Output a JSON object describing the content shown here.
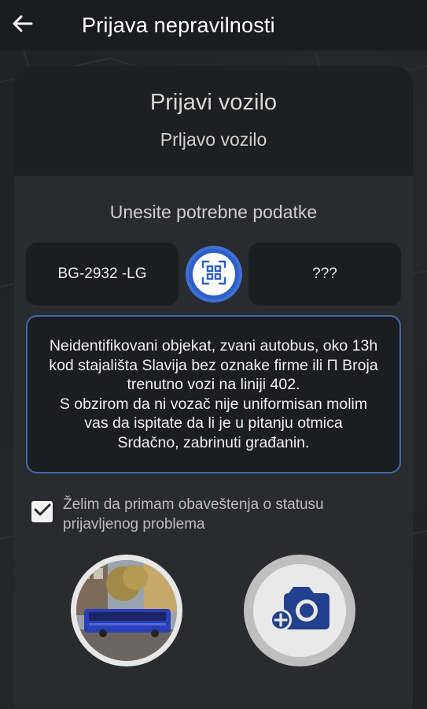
{
  "appbar": {
    "back_icon": "arrow-left-icon",
    "title": "Prijava nepravilnosti"
  },
  "card": {
    "title": "Prijavi vozilo",
    "subtitle": "Prljavo vozilo",
    "instructions": "Unesite potrebne podatke",
    "plate_value": "BG-2932 -LG",
    "scan_icon": "qr-scan-icon",
    "line_value": "???",
    "description": "Neidentifikovani objekat, zvani autobus, oko 13h\nkod stajališta Slavija bez oznake firme ili Π Broja\ntrenutno vozi na liniji 402.\nS obzirom da ni vozač nije uniformisan molim\nvas da ispitate da li je u pitanju otmica\nSrdačno, zabrinuti građanin.",
    "notify_checked": true,
    "notify_label": "Želim da primam obaveštenja o statusu prijavljenog problema",
    "photo_icon": "bus-photo-thumbnail",
    "camera_icon": "add-camera-icon"
  },
  "colors": {
    "accent": "#2d5fc4",
    "camera_icon": "#23408f",
    "background": "#232529",
    "card": "#2a2b2e"
  }
}
